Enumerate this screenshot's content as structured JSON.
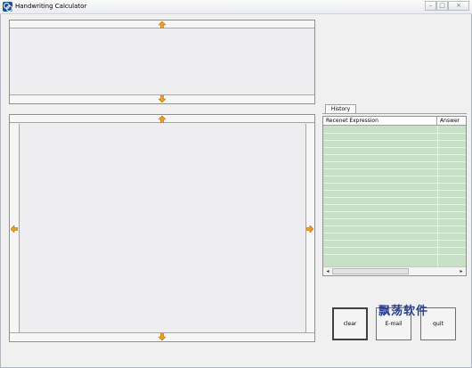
{
  "window": {
    "title": "Handwriting Calculator",
    "controls": [
      "minimize",
      "maximize",
      "close"
    ]
  },
  "history": {
    "tab_label": "History",
    "columns": [
      "Recenet Expression",
      "Answer"
    ],
    "rows": [],
    "row_color": "#c8e0c8"
  },
  "buttons": {
    "clear": "clear",
    "email": "E-mail",
    "quit": "quit"
  },
  "watermark": "飘荡软件",
  "icons": {
    "resize_up": "arrow-up-icon",
    "resize_down": "arrow-down-icon",
    "resize_left": "arrow-left-icon",
    "resize_right": "arrow-right-icon"
  }
}
